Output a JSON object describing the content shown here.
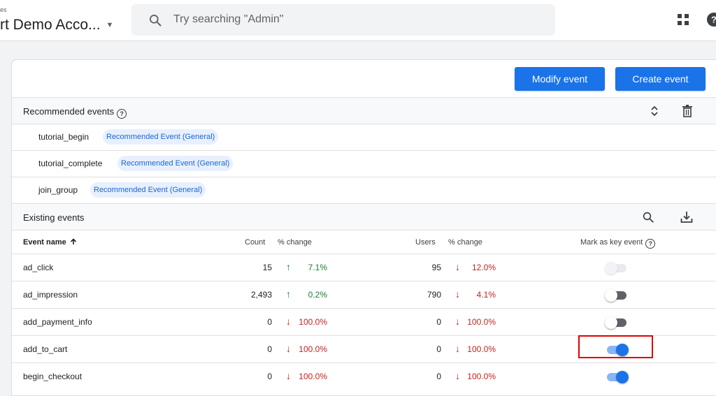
{
  "header": {
    "breadcrumb": "es",
    "account_name": "rt Demo Acco...",
    "search_placeholder": "Try searching \"Admin\""
  },
  "toolbar": {
    "modify_label": "Modify event",
    "create_label": "Create event"
  },
  "recommended": {
    "title": "Recommended events",
    "items": [
      {
        "name": "tutorial_begin",
        "badge": "Recommended Event (General)"
      },
      {
        "name": "tutorial_complete",
        "badge": "Recommended Event (General)"
      },
      {
        "name": "join_group",
        "badge": "Recommended Event (General)"
      }
    ]
  },
  "existing": {
    "title": "Existing events",
    "columns": {
      "event_name": "Event name",
      "count": "Count",
      "count_change": "% change",
      "users": "Users",
      "users_change": "% change",
      "key_event": "Mark as key event"
    },
    "rows": [
      {
        "name": "ad_click",
        "count": "15",
        "count_change": "7.1%",
        "count_dir": "up",
        "users": "95",
        "users_change": "12.0%",
        "users_dir": "down",
        "key_event": "disabled"
      },
      {
        "name": "ad_impression",
        "count": "2,493",
        "count_change": "0.2%",
        "count_dir": "up",
        "users": "790",
        "users_change": "4.1%",
        "users_dir": "down",
        "key_event": "off"
      },
      {
        "name": "add_payment_info",
        "count": "0",
        "count_change": "100.0%",
        "count_dir": "down",
        "users": "0",
        "users_change": "100.0%",
        "users_dir": "down",
        "key_event": "off"
      },
      {
        "name": "add_to_cart",
        "count": "0",
        "count_change": "100.0%",
        "count_dir": "down",
        "users": "0",
        "users_change": "100.0%",
        "users_dir": "down",
        "key_event": "on"
      },
      {
        "name": "begin_checkout",
        "count": "0",
        "count_change": "100.0%",
        "count_dir": "down",
        "users": "0",
        "users_change": "100.0%",
        "users_dir": "down",
        "key_event": "on"
      }
    ]
  },
  "colors": {
    "accent": "#1a73e8",
    "up": "#188038",
    "down": "#c5221f",
    "highlight": "#e00000"
  }
}
